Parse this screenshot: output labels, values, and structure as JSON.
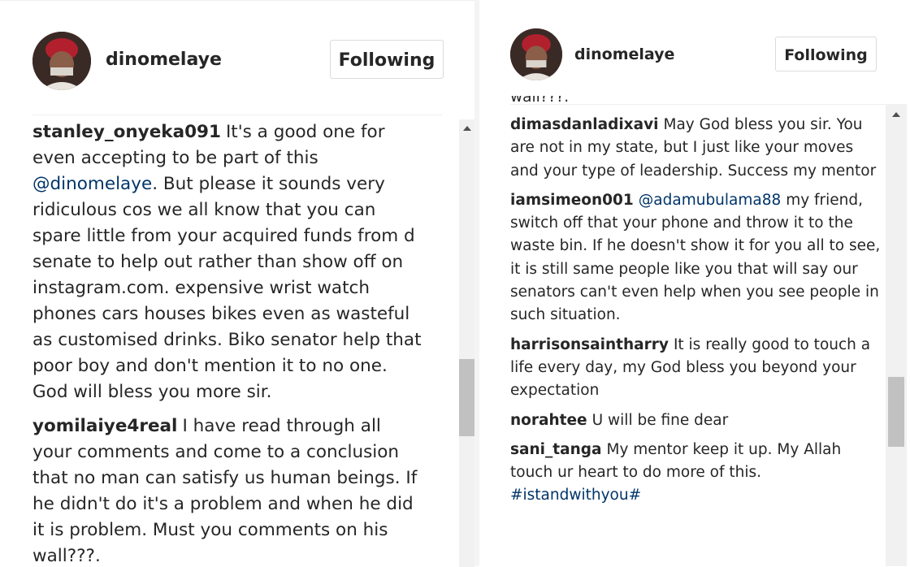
{
  "left": {
    "username": "dinomelaye",
    "follow_label": "Following",
    "comments": [
      {
        "author": "stanley_onyeka091",
        "text_before": "It's a good one for even accepting to be part of this",
        "mention": "@dinomelaye",
        "text_after": ". But please it sounds very ridiculous cos we all know that you can spare little from your acquired funds from d senate to help out rather than show off on instagram.com. expensive wrist watch phones cars houses bikes even as wasteful as customised drinks. Biko senator help that poor boy and don't mention it to no one. God will bless you more sir."
      },
      {
        "author": "yomilaiye4real",
        "text": "I have read through all your comments and come to a conclusion that no man can satisfy us human beings. If he didn't do it's a problem and when he did it is problem. Must you comments on his wall???."
      }
    ]
  },
  "right": {
    "username": "dinomelaye",
    "follow_label": "Following",
    "truncated_text": "wall???.",
    "comments": [
      {
        "author": "dimasdanladixavi",
        "text": "May God bless you sir. You are not in my state, but I just like your moves and your type of leadership. Success my mentor"
      },
      {
        "author": "iamsimeon001",
        "mention": "@adamubulama88",
        "text": "my friend, switch off that your phone and throw it to the waste bin. If he doesn't show it for you all to see, it is still same people like you that will say our senators can't even help when you see people in such situation."
      },
      {
        "author": "harrisonsaintharry",
        "text": "It is really good to touch a life every day, my God bless you beyond your expectation"
      },
      {
        "author": "norahtee",
        "text": "U will be fine dear"
      },
      {
        "author": "sani_tanga",
        "text": "My mentor keep it up. My Allah touch ur heart to do more of this.",
        "hashtag": "#istandwithyou#"
      }
    ]
  }
}
